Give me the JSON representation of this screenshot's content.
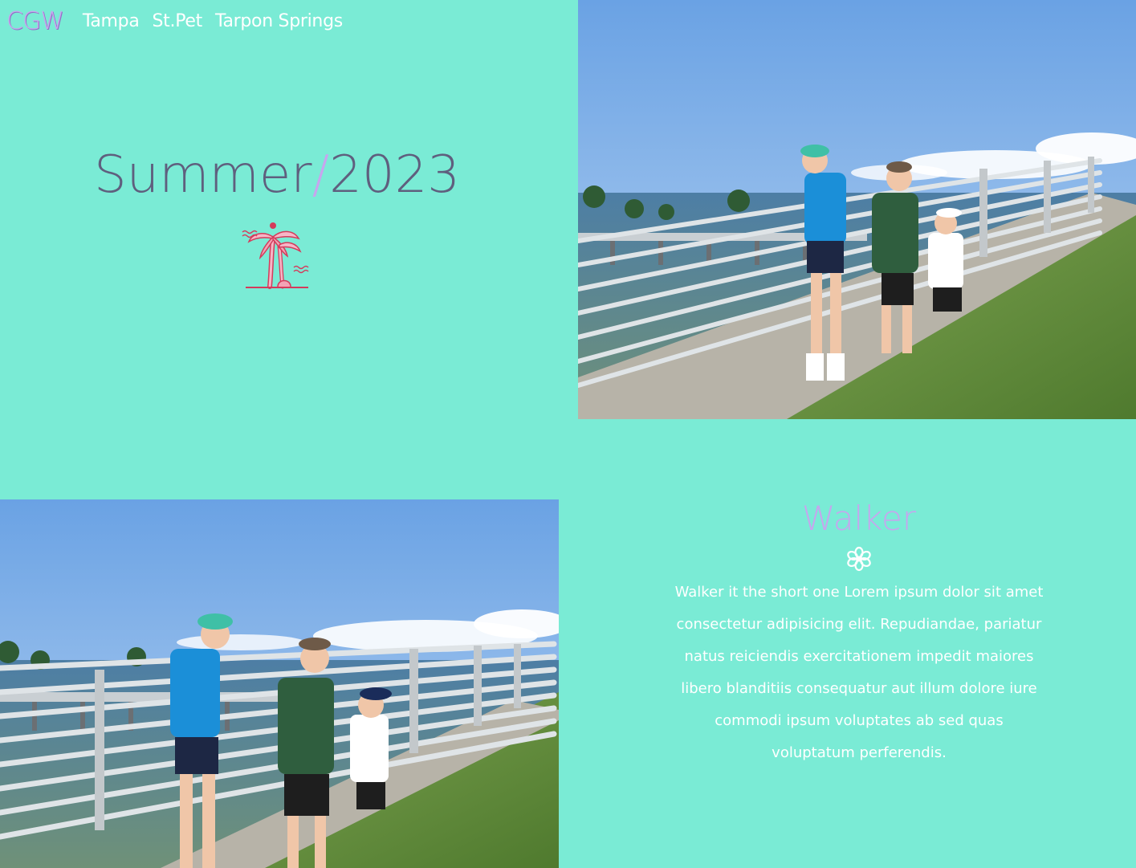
{
  "nav": {
    "brand": "CGW",
    "links": [
      "Tampa",
      "St.Pet",
      "Tarpon Springs"
    ]
  },
  "hero": {
    "title_left": "Summer",
    "title_slash": "/",
    "title_right": "2023",
    "icon": "palm-tree-icon"
  },
  "photos": {
    "top": "photo-kids-pier",
    "bottom": "photo-kids-pier"
  },
  "walker": {
    "name": "Walker",
    "icon": "flower-icon",
    "text": "Walker it the short one Lorem ipsum dolor sit amet consectetur adipisicing elit. Repudiandae, pariatur natus reiciendis exercitationem impedit maiores libero blanditiis consequatur aut illum dolore iure commodi ipsum voluptates ab sed quas voluptatum perferendis."
  },
  "colors": {
    "background": "#7aebd5",
    "accent": "#c6a6ee",
    "title": "#5f5f7e",
    "text": "#ffffff"
  }
}
